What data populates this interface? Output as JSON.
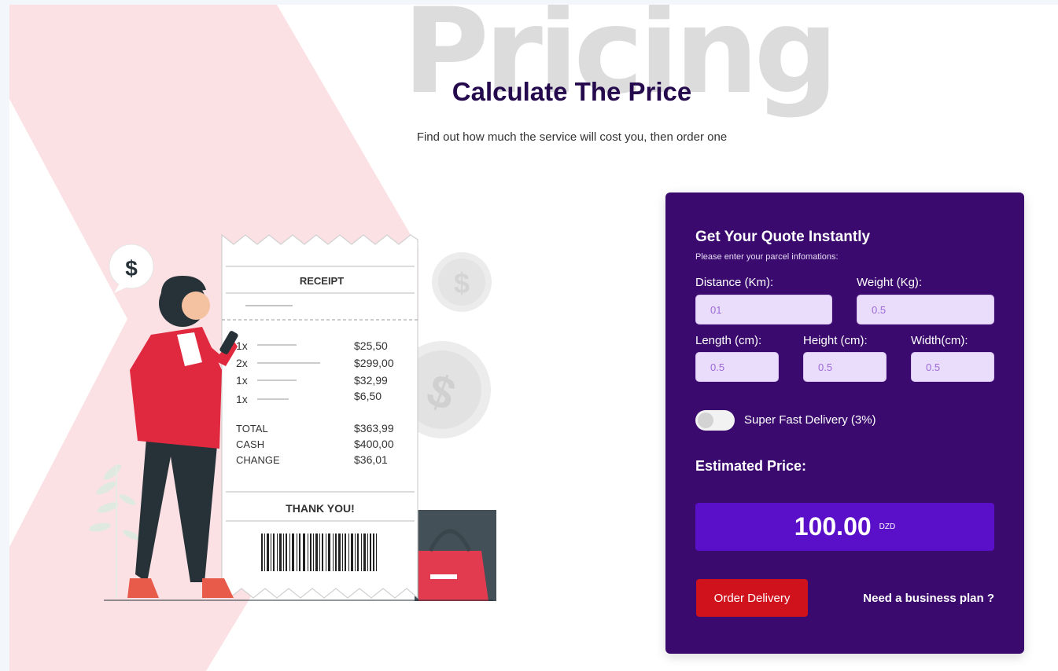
{
  "hero": {
    "background_word": "Pricing",
    "title": "Calculate The Price",
    "subtitle": "Find out how much the service will cost you, then order one"
  },
  "illustration": {
    "bubble_symbol": "$",
    "receipt": {
      "heading": "RECEIPT",
      "items": [
        {
          "qty": "1x",
          "price": "$25,50"
        },
        {
          "qty": "2x",
          "price": "$299,00"
        },
        {
          "qty": "1x",
          "price": "$32,99"
        },
        {
          "qty": "1x",
          "price": "$6,50"
        }
      ],
      "totals": [
        {
          "label": "TOTAL",
          "value": "$363,99"
        },
        {
          "label": "CASH",
          "value": "$400,00"
        },
        {
          "label": "CHANGE",
          "value": "$36,01"
        }
      ],
      "footer": "THANK YOU!"
    }
  },
  "quote": {
    "title": "Get Your Quote Instantly",
    "subtitle": "Please enter your parcel infomations:",
    "fields": {
      "distance": {
        "label": "Distance (Km):",
        "value": "01"
      },
      "weight": {
        "label": "Weight (Kg):",
        "value": "0.5"
      },
      "length": {
        "label": "Length (cm):",
        "value": "0.5"
      },
      "height": {
        "label": "Height (cm):",
        "value": "0.5"
      },
      "width": {
        "label": "Width(cm):",
        "value": "0.5"
      }
    },
    "toggle": {
      "label": "Super Fast Delivery (3%)",
      "on": false
    },
    "estimated_label": "Estimated Price:",
    "price": {
      "value": "100.00",
      "currency": "DZD"
    },
    "order_button": "Order Delivery",
    "business_link": "Need a business plan ?"
  },
  "colors": {
    "card": "#3a0a6e",
    "price_box": "#5a0fc8",
    "input": "#eadcfb",
    "order_button": "#d0121c",
    "title": "#250a4e",
    "accent_red": "#e23a4f",
    "background_shape": "#fbe1e4"
  }
}
